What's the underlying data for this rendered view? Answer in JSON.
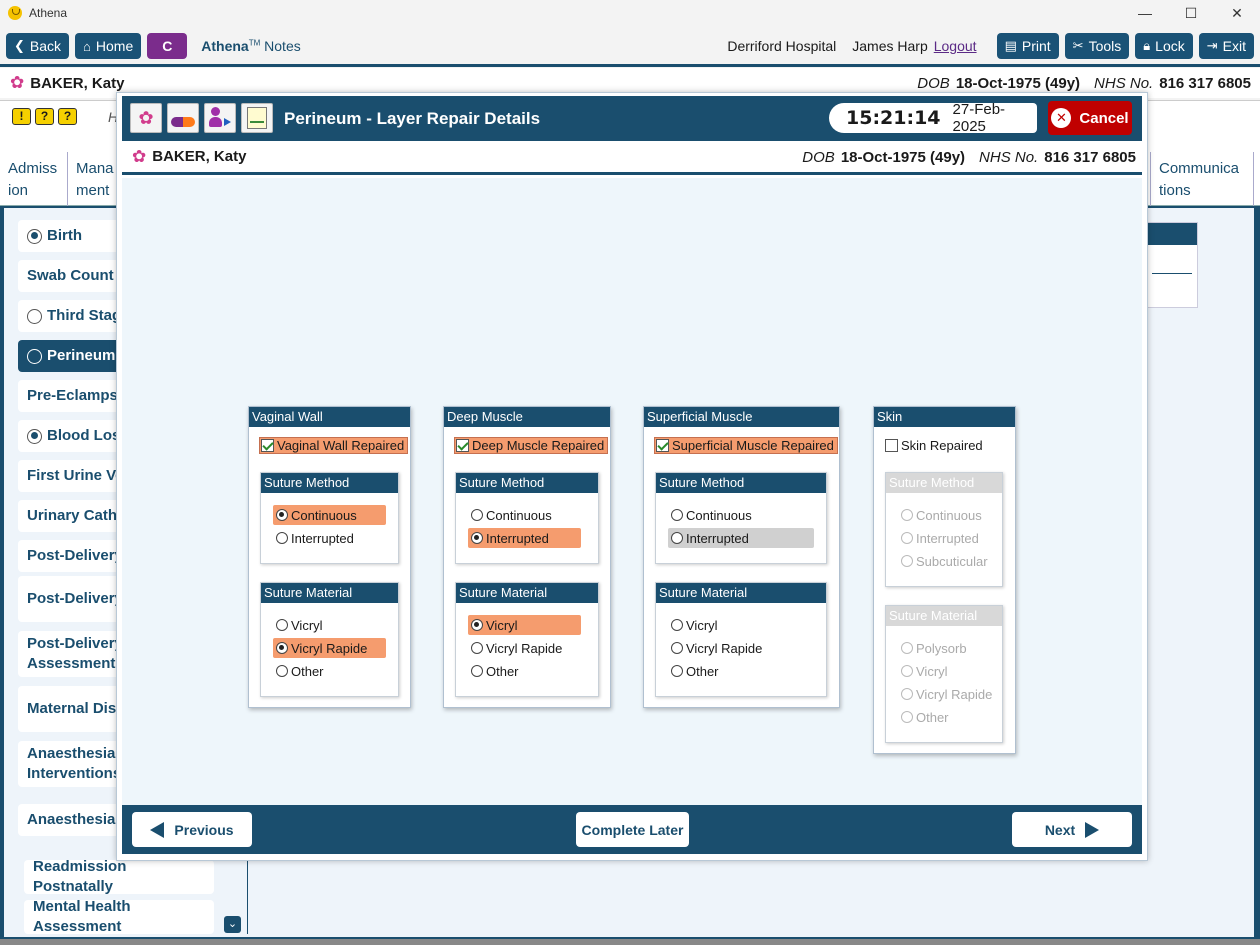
{
  "os": {
    "title": "Athena",
    "min": "—",
    "max": "☐",
    "close": "✕"
  },
  "toolbar": {
    "back": "Back",
    "home": "Home",
    "c": "C",
    "brand_name": "Athena",
    "brand_tm": "TM",
    "brand_suffix": " Notes",
    "hospital": "Derriford Hospital",
    "user": "James Harp",
    "logout": "Logout",
    "print": "Print",
    "tools": "Tools",
    "lock": "Lock",
    "exit": "Exit"
  },
  "patient": {
    "name": "BAKER, Katy",
    "dob_label": "DOB",
    "dob": "18-Oct-1975 (49y)",
    "nhs_label": "NHS No.",
    "nhs": "816 317 6805"
  },
  "background": {
    "h_text": "H",
    "tabs": [
      "Admiss ion",
      "Mana ment",
      "Communica tions"
    ],
    "side_items": [
      {
        "label": "Birth",
        "radio": "on"
      },
      {
        "label": "Swab Count",
        "radio": "none"
      },
      {
        "label": "Third Stage",
        "radio": "off"
      },
      {
        "label": "Perineum",
        "radio": "off",
        "selected": true
      },
      {
        "label": "Pre-Eclampsia",
        "radio": "none"
      },
      {
        "label": "Blood Loss",
        "radio": "on"
      },
      {
        "label": "First Urine Voi",
        "radio": "none"
      },
      {
        "label": "Urinary Cathe",
        "radio": "none"
      },
      {
        "label": "Post-Delivery",
        "radio": "none"
      },
      {
        "label": "Post-Delivery Notes",
        "radio": "none"
      },
      {
        "label": "Post-Delivery Assessments",
        "radio": "none"
      },
      {
        "label": "Maternal Disc Summary",
        "radio": "none"
      },
      {
        "label": "Anaesthesia Interventions",
        "radio": "none"
      },
      {
        "label": "Anaesthesia F",
        "radio": "none"
      },
      {
        "label": "Readmission Postnatally",
        "radio": "none"
      },
      {
        "label": "Mental Health Assessment",
        "radio": "none"
      }
    ]
  },
  "modal": {
    "title": "Perineum - Layer Repair Details",
    "time": "15:21:14",
    "date": "27-Feb-2025",
    "cancel": "Cancel",
    "previous": "Previous",
    "complete_later": "Complete Later",
    "next": "Next"
  },
  "layers": [
    {
      "title": "Vaginal Wall",
      "repaired_label": "Vaginal Wall Repaired",
      "repaired": true,
      "method_title": "Suture Method",
      "method_options": [
        "Continuous",
        "Interrupted"
      ],
      "method_selected": 0,
      "material_title": "Suture Material",
      "material_options": [
        "Vicryl",
        "Vicryl Rapide",
        "Other"
      ],
      "material_selected": 1
    },
    {
      "title": "Deep Muscle",
      "repaired_label": "Deep Muscle Repaired",
      "repaired": true,
      "method_title": "Suture Method",
      "method_options": [
        "Continuous",
        "Interrupted"
      ],
      "method_selected": 1,
      "material_title": "Suture Material",
      "material_options": [
        "Vicryl",
        "Vicryl Rapide",
        "Other"
      ],
      "material_selected": 0
    },
    {
      "title": "Superficial Muscle",
      "repaired_label": "Superficial Muscle Repaired",
      "repaired": true,
      "method_title": "Suture Method",
      "method_options": [
        "Continuous",
        "Interrupted"
      ],
      "method_selected": -1,
      "method_hover": 1,
      "material_title": "Suture Material",
      "material_options": [
        "Vicryl",
        "Vicryl Rapide",
        "Other"
      ],
      "material_selected": -1
    },
    {
      "title": "Skin",
      "repaired_label": "Skin Repaired",
      "repaired": false,
      "method_title": "Suture Method",
      "method_options": [
        "Continuous",
        "Interrupted",
        "Subcuticular"
      ],
      "method_selected": -1,
      "material_title": "Suture Material",
      "material_options": [
        "Polysorb",
        "Vicryl",
        "Vicryl Rapide",
        "Other"
      ],
      "material_selected": -1
    }
  ],
  "colors": {
    "navy": "#1a4e6e",
    "selected": "#f59c6e",
    "cancel": "#c00000"
  }
}
